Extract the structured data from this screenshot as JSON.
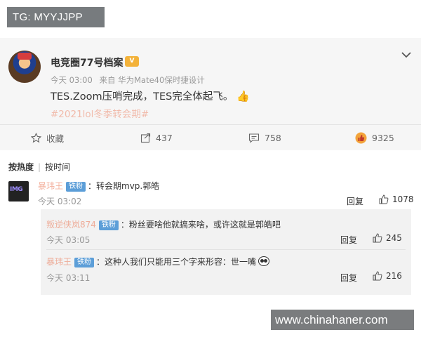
{
  "overlay": {
    "tg_label": "TG: MYYJJPP",
    "watermark": "www.chinahaner.com"
  },
  "post": {
    "author": "电竞圈77号档案",
    "time": "今天 03:00",
    "source": "来自 华为Mate40保时捷设计",
    "content": "TES.Zoom压哨完成，TES完全体起飞。",
    "hashtag": "#2021lol冬季转会期#",
    "thumb_emoji": "👍",
    "icons": {
      "author_badge": "vip-icon",
      "expand": "chevron-down-icon"
    }
  },
  "actions": {
    "favorite_label": "收藏",
    "repost_count": "437",
    "comment_count": "758",
    "like_count": "9325",
    "like_icon_color": "#f3a33a"
  },
  "comments": {
    "sort_hot": "按热度",
    "sort_time": "按时间",
    "items": [
      {
        "name": "暴玮王",
        "badge": "铁粉",
        "text": "：转会期mvp.郭皓",
        "time": "今天 03:02",
        "reply": "回复",
        "likes": "1078"
      },
      {
        "name": "叛逆侠岚874",
        "badge": "铁粉",
        "text": "：粉丝要啥他就搞来啥，或许这就是郭皓吧",
        "time": "今天 03:05",
        "reply": "回复",
        "likes": "245"
      },
      {
        "name": "暴玮王",
        "badge": "铁粉",
        "text": "：这种人我们只能用三个字来形容：世一嘴",
        "time": "今天 03:11",
        "reply": "回复",
        "likes": "216"
      }
    ],
    "first_avatar_text": "IMG"
  },
  "colors": {
    "page_bg": "#f6f6f6",
    "accent_orange": "#eb7350",
    "fan_badge": "#5c9ed8"
  }
}
